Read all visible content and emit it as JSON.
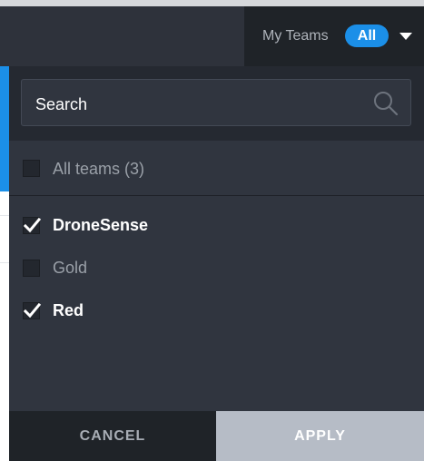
{
  "header": {
    "my_teams_label": "My Teams",
    "filter_pill": "All"
  },
  "dropdown": {
    "search_placeholder": "Search",
    "all_teams": {
      "label": "All teams (3)",
      "checked": false
    },
    "teams": [
      {
        "label": "DroneSense",
        "checked": true
      },
      {
        "label": "Gold",
        "checked": false
      },
      {
        "label": "Red",
        "checked": true
      }
    ],
    "cancel_label": "CANCEL",
    "apply_label": "APPLY"
  },
  "colors": {
    "accent": "#1b8fe8",
    "panel": "#30353f",
    "apply_disabled": "#b6bcc6"
  }
}
